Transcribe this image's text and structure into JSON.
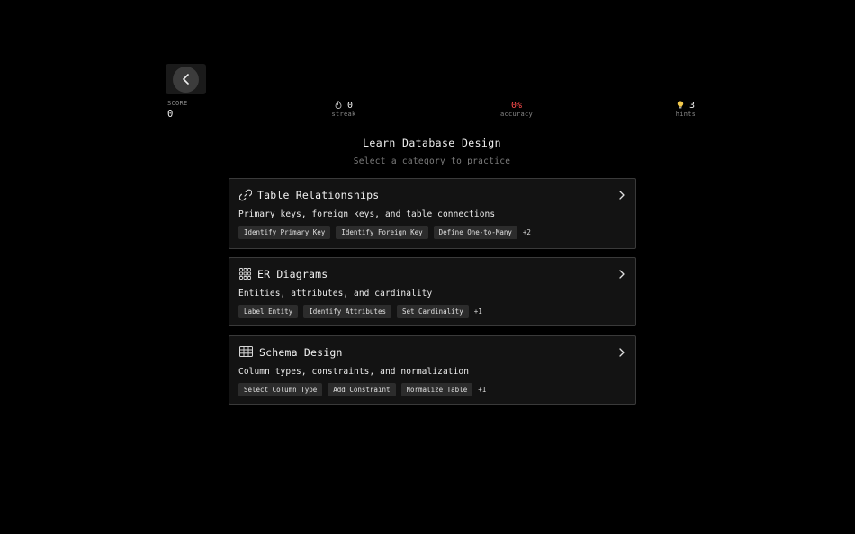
{
  "stats": {
    "score": {
      "label": "SCORE",
      "value": "0"
    },
    "streak": {
      "icon": "flame-icon",
      "value": "0",
      "label": "streak"
    },
    "accuracy": {
      "value": "0%",
      "label": "accuracy"
    },
    "hints": {
      "icon": "lightbulb-icon",
      "value": "3",
      "label": "hints"
    }
  },
  "header": {
    "title": "Learn Database Design",
    "subtitle": "Select a category to practice"
  },
  "categories": [
    {
      "icon": "link-icon",
      "title": "Table Relationships",
      "description": "Primary keys, foreign keys, and table connections",
      "tags": [
        "Identify Primary Key",
        "Identify Foreign Key",
        "Define One-to-Many"
      ],
      "more": "+2"
    },
    {
      "icon": "grid-icon",
      "title": "ER Diagrams",
      "description": "Entities, attributes, and cardinality",
      "tags": [
        "Label Entity",
        "Identify Attributes",
        "Set Cardinality"
      ],
      "more": "+1"
    },
    {
      "icon": "table-icon",
      "title": "Schema Design",
      "description": "Column types, constraints, and normalization",
      "tags": [
        "Select Column Type",
        "Add Constraint",
        "Normalize Table"
      ],
      "more": "+1"
    }
  ],
  "colors": {
    "background": "#000000",
    "card": "#131313",
    "accuracy": "#ff4d4d"
  }
}
